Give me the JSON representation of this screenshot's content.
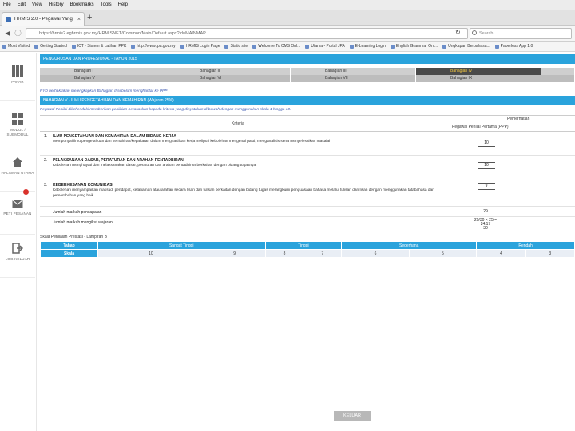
{
  "menu": [
    "File",
    "Edit",
    "View",
    "History",
    "Bookmarks",
    "Tools",
    "Help"
  ],
  "tab": {
    "title": "HRMIS 2.0 - Pegawai Yang ...",
    "close": "×",
    "new": "+"
  },
  "nav": {
    "url": "https://hrmis2.eghrmis.gov.my/HRMISNET/Common/Main/Default.aspx?id=MAINMAP",
    "search_placeholder": "Search"
  },
  "bookmarks": [
    "Most Visited",
    "Getting Started",
    "ICT - Sistem & Latihan PPK",
    "http://www.jpa.gov.my",
    "HRMIS Login Page",
    "Static site",
    "Welcome To CMS Onl...",
    "Utama - Portal JPA",
    "E-Learning Login",
    "English Grammar Onl...",
    "Ungkapan Berbahasa...",
    "Paperless App 1.0"
  ],
  "sidebar": [
    {
      "label": "PAPAR",
      "icon": "apps-grid-icon"
    },
    {
      "label": "MODUL / SUBMODUL",
      "icon": "module-grid-icon"
    },
    {
      "label": "HALAMAN UTAMA",
      "icon": "home-icon"
    },
    {
      "label": "PETI PESANAN",
      "icon": "mail-icon",
      "badge": "!"
    },
    {
      "label": "LOG KELUAR",
      "icon": "logout-icon"
    }
  ],
  "main": {
    "title": "PENGURUSAN DAN PROFESIONAL - TAHUN 2015",
    "bahagian_row1": [
      "Bahagian I",
      "Bahagian II",
      "Bahagian III",
      "Bahagian IV"
    ],
    "bahagian_row2": [
      "Bahagian V",
      "Bahagian VI",
      "Bahagian VII",
      "Bahagian IX"
    ],
    "notice": "PYD berhak/akan melengkapkan Bahagian II sebelum menghantar ke PPP",
    "section_title": "BAHAGIAN V - ILMU PENGETAHUAN DAN KEMAHIRAN (Wajaran 25%)",
    "instruction": "Pegawai Penilai dikehendaki memberikan penilaian berasaskan kepada kriteria yang dinyatakan di bawah dengan menggunakan skala 1 hingga 10.",
    "col_kriteria": "Kriteria",
    "col_pemerhatian": "Pemerhatian",
    "col_ppp": "Pegawai Penilai Pertama (PPP)",
    "criteria": [
      {
        "no": "1.",
        "title": "ILMU PENGETAHUAN DAN KEMAHIRAN DALAM BIDANG KERJA",
        "desc": "Mempunyai ilmu pengetahuan dan kemahiran/kepakaran dalam menghasilkan kerja meliputi kebolehan mengenal pasti, menganalisis serta menyelesaikan masalah",
        "score": "10"
      },
      {
        "no": "2.",
        "title": "PELAKSANAAN DASAR, PERATURAN DAN ARAHAN PENTADBIRAN",
        "desc": "Kebolehan menghayati dan melaksanakan dasar, peraturan dan arahan pentadbiran berkaitan dengan bidang tugasnya.",
        "score": "10"
      },
      {
        "no": "3.",
        "title": "KEBERKESANAN KOMUNIKASI",
        "desc": "Kebolehan menyampaikan maksud, pendapat, kefahaman atau arahan secara lisan dan tulisan berkaitan dengan bidang tugas merangkumi penguasaan bahasa melalui tulisan dan lisan dengan menggunakan tatabahasa dan persembahan yang baik",
        "score": "9"
      }
    ],
    "jumlah_pencapaian_label": "Jumlah markah pencapaian",
    "jumlah_pencapaian_value": "29",
    "jumlah_wajaran_label": "Jumlah markah mengikut wajaran",
    "jumlah_wajaran_value_line1": "29/30 × 25 = 24.17",
    "jumlah_wajaran_value_line2": "30",
    "skala_title": "Skala Penilaian Prestasi - Lampiran B",
    "skala_header": [
      "Tahap",
      "Sangat Tinggi",
      "Tinggi",
      "Sederhana",
      "Rendah"
    ],
    "skala_label": "Skala",
    "skala_values": [
      "10",
      "9",
      "8",
      "7",
      "6",
      "5",
      "4",
      "3"
    ],
    "keluar": "KELUAR"
  },
  "colors": {
    "accent": "#2aa3dc",
    "active_tab_text": "#f2c640",
    "badge": "#d9312b"
  }
}
